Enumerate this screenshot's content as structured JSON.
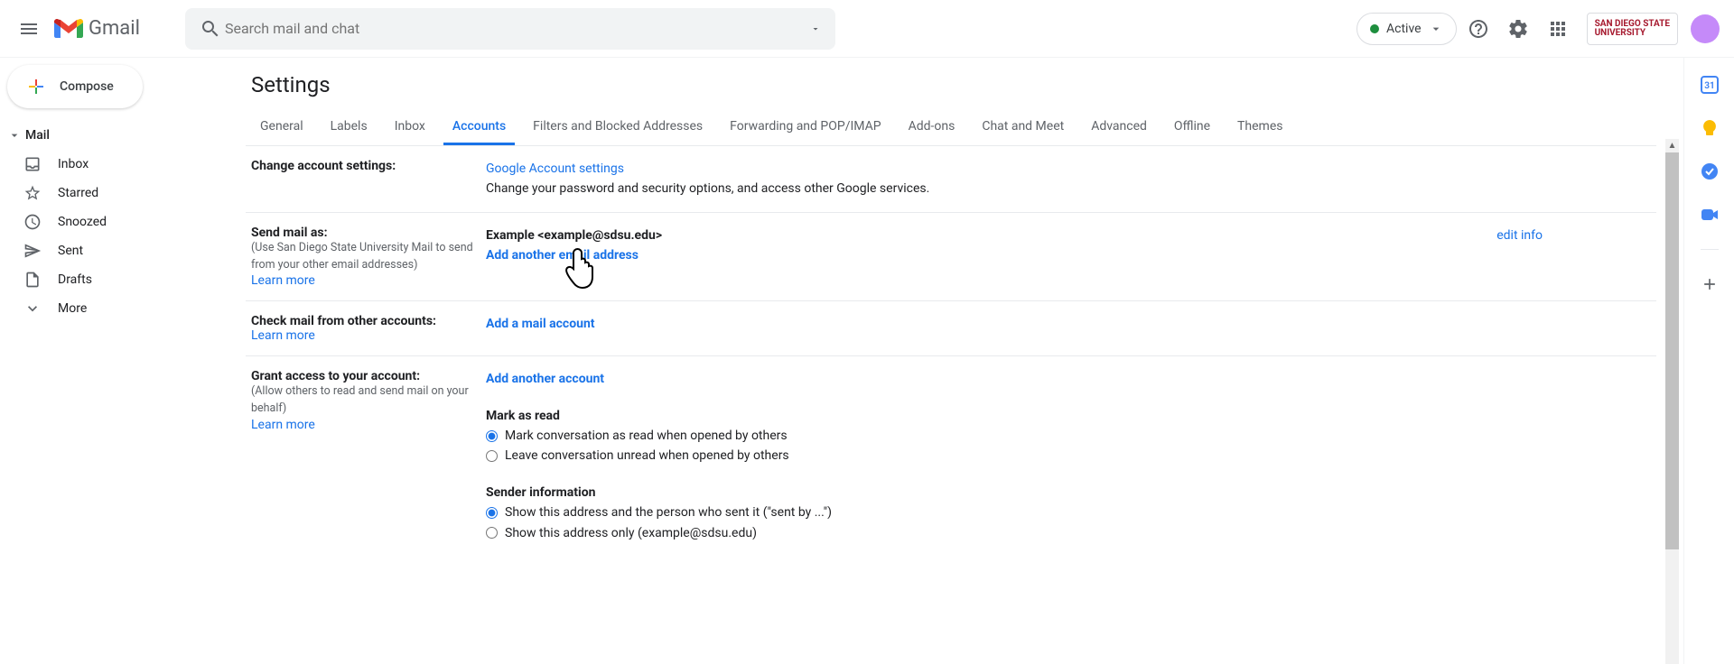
{
  "header": {
    "gmail_label": "Gmail",
    "search_placeholder": "Search mail and chat",
    "status_label": "Active",
    "org_line1": "SAN DIEGO STATE",
    "org_line2": "UNIVERSITY"
  },
  "sidebar": {
    "compose": "Compose",
    "mail_section": "Mail",
    "items": [
      {
        "icon": "inbox",
        "label": "Inbox"
      },
      {
        "icon": "star",
        "label": "Starred"
      },
      {
        "icon": "clock",
        "label": "Snoozed"
      },
      {
        "icon": "send",
        "label": "Sent"
      },
      {
        "icon": "file",
        "label": "Drafts"
      },
      {
        "icon": "more",
        "label": "More"
      }
    ]
  },
  "settings": {
    "title": "Settings",
    "tabs": [
      "General",
      "Labels",
      "Inbox",
      "Accounts",
      "Filters and Blocked Addresses",
      "Forwarding and POP/IMAP",
      "Add-ons",
      "Chat and Meet",
      "Advanced",
      "Offline",
      "Themes"
    ],
    "active_tab": "Accounts",
    "sections": {
      "change_account": {
        "title": "Change account settings:",
        "link": "Google Account settings",
        "desc": "Change your password and security options, and access other Google services."
      },
      "send_as": {
        "title": "Send mail as:",
        "sub": "(Use San Diego State University Mail to send from your other email addresses)",
        "learn": "Learn more",
        "account": "Example <example@sdsu.edu>",
        "add_link": "Add another email address",
        "edit": "edit info"
      },
      "check_mail": {
        "title": "Check mail from other accounts:",
        "learn": "Learn more",
        "add_link": "Add a mail account"
      },
      "grant": {
        "title": "Grant access to your account:",
        "sub": "(Allow others to read and send mail on your behalf)",
        "learn": "Learn more",
        "add_link": "Add another account",
        "mark_header": "Mark as read",
        "mark_opt1": "Mark conversation as read when opened by others",
        "mark_opt2": "Leave conversation unread when opened by others",
        "sender_header": "Sender information",
        "sender_opt1": "Show this address and the person who sent it (\"sent by ...\")",
        "sender_opt2": "Show this address only (example@sdsu.edu)"
      }
    }
  }
}
